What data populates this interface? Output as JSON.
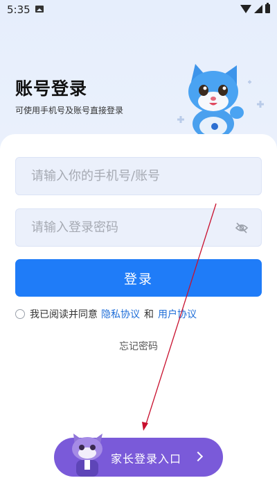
{
  "status_bar": {
    "time": "5:35"
  },
  "header": {
    "title": "账号登录",
    "subtitle": "可使用手机号及账号直接登录"
  },
  "form": {
    "account_placeholder": "请输入你的手机号/账号",
    "password_placeholder": "请输入登录密码",
    "login_label": "登录",
    "agree_prefix": "我已阅读并同意",
    "privacy_link": "隐私协议",
    "and": "和",
    "user_link": "用户协议",
    "forgot_label": "忘记密码"
  },
  "parent_entry": {
    "label": "家长登录入口"
  },
  "colors": {
    "primary": "#1f7cf8",
    "link": "#1f6ed8",
    "parent_button": "#7a5ad9",
    "annotation_arrow": "#c8102e"
  }
}
